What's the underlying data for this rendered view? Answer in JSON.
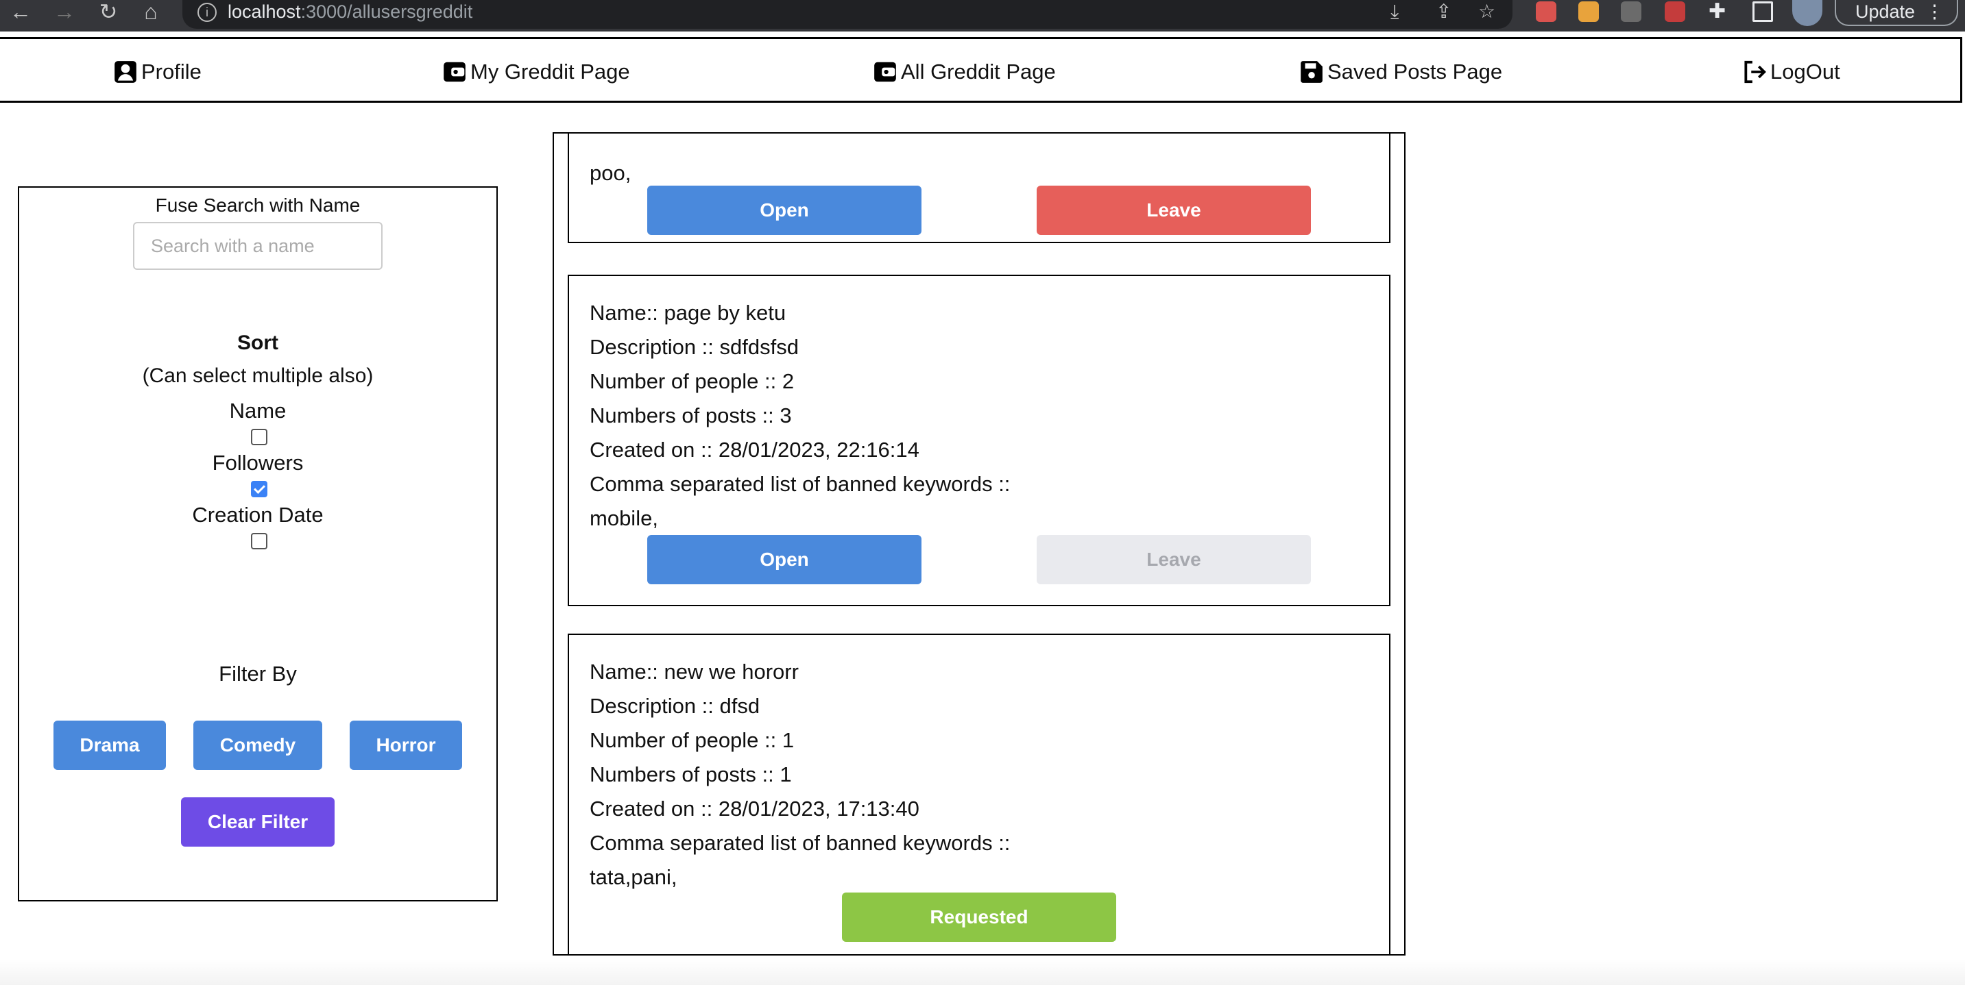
{
  "browser": {
    "url_host": "localhost",
    "url_path": ":3000/allusersgreddit",
    "update_label": "Update"
  },
  "nav": {
    "profile": "Profile",
    "my_greddit": "My Greddit Page",
    "all_greddit": "All Greddit Page",
    "saved_posts": "Saved Posts Page",
    "logout": "LogOut"
  },
  "sidebar": {
    "search_label": "Fuse Search with Name",
    "search_placeholder": "Search with a name",
    "sort_title": "Sort",
    "sort_subtitle": "(Can select multiple also)",
    "sort_options": [
      {
        "label": "Name",
        "checked": false
      },
      {
        "label": "Followers",
        "checked": true
      },
      {
        "label": "Creation Date",
        "checked": false
      }
    ],
    "filter_title": "Filter By",
    "filters": [
      "Drama",
      "Comedy",
      "Horror"
    ],
    "clear_filter": "Clear Filter"
  },
  "cards": [
    {
      "keywords": "poo,",
      "open_label": "Open",
      "leave_label": "Leave"
    },
    {
      "name": "Name:: page by ketu",
      "description": "Description :: sdfdsfsd",
      "people": "Number of people :: 2",
      "posts": "Numbers of posts :: 3",
      "created": "Created on :: 28/01/2023, 22:16:14",
      "keywords_label": "Comma separated list of banned keywords ::",
      "keywords": "mobile,",
      "open_label": "Open",
      "leave_label": "Leave"
    },
    {
      "name": "Name:: new we hororr",
      "description": "Description :: dfsd",
      "people": "Number of people :: 1",
      "posts": "Numbers of posts :: 1",
      "created": "Created on :: 28/01/2023, 17:13:40",
      "keywords_label": "Comma separated list of banned keywords ::",
      "keywords": "tata,pani,",
      "requested_label": "Requested"
    }
  ]
}
